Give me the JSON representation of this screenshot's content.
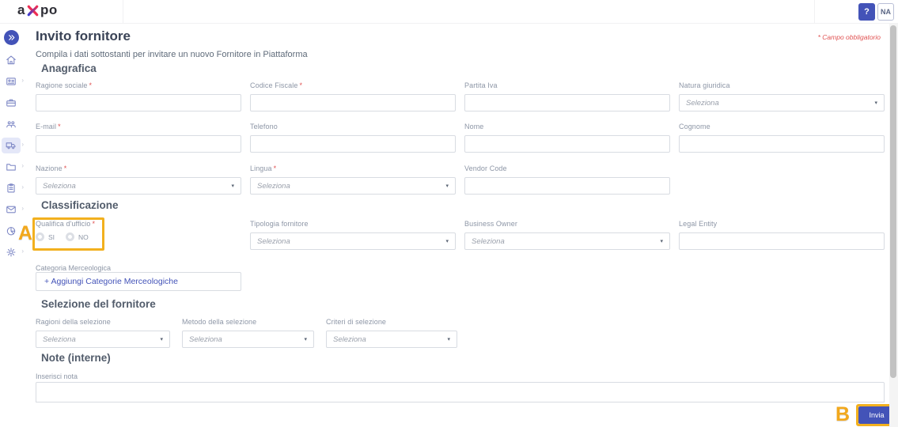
{
  "header": {
    "logo_prefix": "a",
    "logo_suffix": "po",
    "help_label": "?",
    "user_initials": "NA"
  },
  "sidebar": {
    "items": [
      {
        "icon": "double-chevron-right-icon"
      },
      {
        "icon": "home-icon"
      },
      {
        "icon": "id-card-icon",
        "expandable": true
      },
      {
        "icon": "briefcase-icon"
      },
      {
        "icon": "people-icon"
      },
      {
        "icon": "truck-icon",
        "expandable": true,
        "active": true
      },
      {
        "icon": "folder-icon",
        "expandable": true
      },
      {
        "icon": "clipboard-icon",
        "expandable": true
      },
      {
        "icon": "envelope-icon",
        "expandable": true
      },
      {
        "icon": "pie-chart-icon",
        "expandable": true
      },
      {
        "icon": "gear-icon",
        "expandable": true
      }
    ]
  },
  "page": {
    "title": "Invito fornitore",
    "subtitle": "Compila i dati sottostanti per invitare un nuovo Fornitore in Piattaforma",
    "required_note": "* Campo obbligatorio"
  },
  "misc": {
    "required_mark": "*",
    "select_placeholder": "Seleziona",
    "dropdown_arrow": "▾",
    "chevron": "›"
  },
  "anagrafica": {
    "title": "Anagrafica",
    "fields": {
      "ragione_sociale": {
        "label": "Ragione sociale",
        "required": true,
        "type": "text"
      },
      "codice_fiscale": {
        "label": "Codice Fiscale",
        "required": true,
        "type": "text"
      },
      "partita_iva": {
        "label": "Partita Iva",
        "required": false,
        "type": "text"
      },
      "natura_giuridica": {
        "label": "Natura giuridica",
        "required": false,
        "type": "select",
        "value": "Seleziona"
      },
      "email": {
        "label": "E-mail",
        "required": true,
        "type": "text"
      },
      "telefono": {
        "label": "Telefono",
        "required": false,
        "type": "text"
      },
      "nome": {
        "label": "Nome",
        "required": false,
        "type": "text"
      },
      "cognome": {
        "label": "Cognome",
        "required": false,
        "type": "text"
      },
      "nazione": {
        "label": "Nazione",
        "required": true,
        "type": "select",
        "value": "Seleziona"
      },
      "lingua": {
        "label": "Lingua",
        "required": true,
        "type": "select",
        "value": "Seleziona"
      },
      "vendor_code": {
        "label": "Vendor Code",
        "required": false,
        "type": "text"
      }
    }
  },
  "classificazione": {
    "title": "Classificazione",
    "qualifica": {
      "label": "Qualifica d'ufficio",
      "required": true,
      "options": [
        "SI",
        "NO"
      ],
      "selected": null
    },
    "tipologia": {
      "label": "Tipologia fornitore",
      "type": "select",
      "value": "Seleziona"
    },
    "business_owner": {
      "label": "Business Owner",
      "type": "select",
      "value": "Seleziona"
    },
    "legal_entity": {
      "label": "Legal Entity",
      "type": "text"
    },
    "categoria": {
      "label": "Categoria Merceologica",
      "add_button": "+ Aggiungi Categorie Merceologiche"
    }
  },
  "selezione": {
    "title": "Selezione del fornitore",
    "ragioni": {
      "label": "Ragioni della selezione",
      "type": "select",
      "value": "Seleziona"
    },
    "metodo": {
      "label": "Metodo della selezione",
      "type": "select",
      "value": "Seleziona"
    },
    "criteri": {
      "label": "Criteri di selezione",
      "type": "select",
      "value": "Seleziona"
    }
  },
  "note": {
    "title": "Note (interne)",
    "label": "Inserisci nota",
    "value": ""
  },
  "footer": {
    "submit_label": "Invia"
  },
  "annotations": {
    "a_label": "A",
    "b_label": "B",
    "highlight_color": "#f2b01e"
  },
  "colors": {
    "accent": "#4353b8",
    "required": "#e05252",
    "logo_red": "#ee2d53",
    "logo_blue": "#3b3bd0"
  }
}
